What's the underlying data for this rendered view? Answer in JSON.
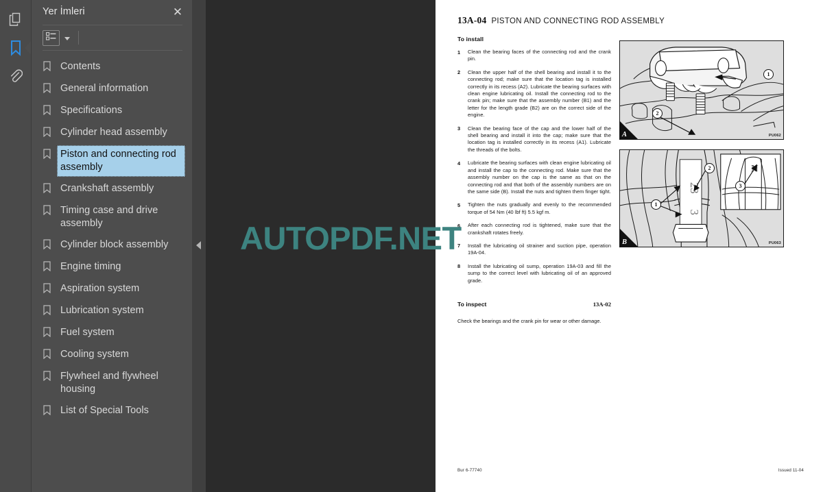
{
  "rail": {
    "items": [
      {
        "name": "pages-thumbnails-icon",
        "label": "Sayfa Küçük Resimleri",
        "active": false
      },
      {
        "name": "bookmarks-icon",
        "label": "Yer İmleri",
        "active": true
      },
      {
        "name": "attachments-icon",
        "label": "Ekler",
        "active": false
      }
    ],
    "accent": "#2e8ce0"
  },
  "sidebar": {
    "title": "Yer İmleri",
    "close_label": "✕",
    "toolbar": {
      "options_icon": "list-options-icon",
      "caret_icon": "chevron-down-icon"
    },
    "items": [
      {
        "label": "Contents",
        "selected": false
      },
      {
        "label": "General information",
        "selected": false
      },
      {
        "label": "Specifications",
        "selected": false
      },
      {
        "label": "Cylinder head assembly",
        "selected": false
      },
      {
        "label": "Piston and connecting rod assembly",
        "selected": true
      },
      {
        "label": "Crankshaft assembly",
        "selected": false
      },
      {
        "label": "Timing case and drive assembly",
        "selected": false
      },
      {
        "label": "Cylinder block assembly",
        "selected": false
      },
      {
        "label": "Engine timing",
        "selected": false
      },
      {
        "label": "Aspiration system",
        "selected": false
      },
      {
        "label": "Lubrication system",
        "selected": false
      },
      {
        "label": "Fuel system",
        "selected": false
      },
      {
        "label": "Cooling system",
        "selected": false
      },
      {
        "label": "Flywheel and flywheel housing",
        "selected": false
      },
      {
        "label": "List of Special Tools",
        "selected": false
      }
    ],
    "selection_bg": "#a6d0ea"
  },
  "splitter": {
    "collapse_icon": "chevron-left-icon"
  },
  "viewer": {
    "background": "#2b2b2b",
    "watermark": "AUTOPDF.NET",
    "watermark_color": "#3d8380",
    "cursor_icon": "arrow-marquee-select-cursor"
  },
  "document": {
    "operation_number": "13A-04",
    "operation_title": "PISTON AND CONNECTING ROD ASSEMBLY",
    "install": {
      "heading": "To install",
      "steps": [
        {
          "n": "1",
          "text": "Clean the bearing faces of the connecting rod and the crank pin."
        },
        {
          "n": "2",
          "text": "Clean the upper half of the shell bearing and install it to the connecting rod; make sure that the location tag is installed correctly in its recess (A2). Lubricate the bearing surfaces with clean engine lubricating oil. Install the connecting rod to the crank pin; make sure that the assembly number (B1) and the letter for the length grade (B2) are on the correct side of the engine."
        },
        {
          "n": "3",
          "text": "Clean the bearing face of the cap and the lower half of the shell bearing and install it into the cap; make sure that the location tag is installed correctly in its recess (A1). Lubricate the threads of the bolts."
        },
        {
          "n": "4",
          "text": "Lubricate the bearing surfaces with clean engine lubricating oil and install the cap to the connecting rod. Make sure that the assembly number on the cap is the same as that on the connecting rod and that both of the assembly numbers are on the same side (B). Install the nuts and tighten them finger tight."
        },
        {
          "n": "5",
          "text": "Tighten the nuts gradually and evenly to the recommended torque of 54 Nm (40 lbf ft) 5.5 kgf m."
        },
        {
          "n": "6",
          "text": "After each connecting rod is tightened, make sure that the crankshaft rotates freely."
        },
        {
          "n": "7",
          "text": "Install the lubricating oil strainer and suction pipe, operation 19A-04."
        },
        {
          "n": "8",
          "text": "Install the lubricating oil sump, operation 19A-03 and fill the sump to the correct level with lubricating oil of an approved grade."
        }
      ]
    },
    "inspect": {
      "heading": "To inspect",
      "reference": "13A-02",
      "body": "Check the bearings and the crank pin for wear or other damage."
    },
    "figures": [
      {
        "letter": "A",
        "code": "PU062",
        "callouts": [
          "1",
          "2"
        ],
        "alt": "connecting rod cap and shell bearing installation"
      },
      {
        "letter": "B",
        "code": "PU063",
        "callouts": [
          "1",
          "2",
          "3"
        ],
        "alt": "assembly number and length grade letter locations"
      }
    ],
    "footer": {
      "left": "Bur 6-77740",
      "right": "Issued 11-04"
    }
  }
}
